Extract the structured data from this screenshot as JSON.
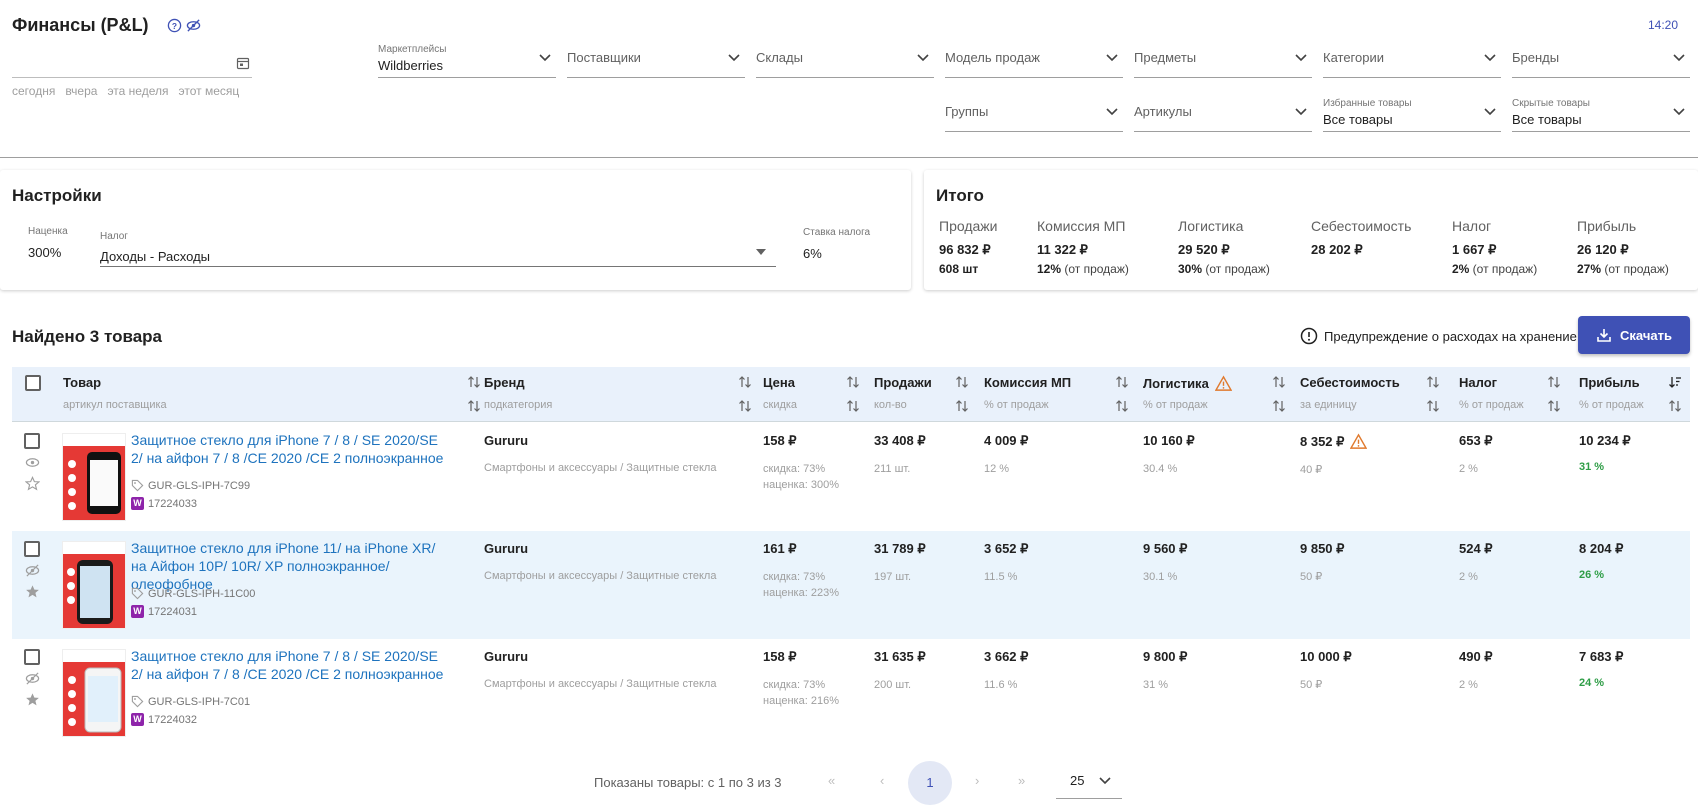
{
  "header": {
    "title": "Финансы (P&L)",
    "time": "14:20"
  },
  "date": {
    "value": "",
    "quick": [
      "сегодня",
      "вчера",
      "эта неделя",
      "этот месяц"
    ]
  },
  "filters": {
    "marketplaces": {
      "label": "Маркетплейсы",
      "value": "Wildberries"
    },
    "suppliers": {
      "placeholder": "Поставщики"
    },
    "warehouses": {
      "placeholder": "Склады"
    },
    "sales_model": {
      "placeholder": "Модель продаж"
    },
    "subjects": {
      "placeholder": "Предметы"
    },
    "categories": {
      "placeholder": "Категории"
    },
    "brands": {
      "placeholder": "Бренды"
    },
    "groups": {
      "placeholder": "Группы"
    },
    "articles": {
      "placeholder": "Артикулы"
    },
    "favorites": {
      "label": "Избранные товары",
      "value": "Все товары"
    },
    "hidden": {
      "label": "Скрытые товары",
      "value": "Все товары"
    }
  },
  "settings": {
    "title": "Настройки",
    "markup_label": "Наценка",
    "markup_value": "300%",
    "tax_label": "Налог",
    "tax_value": "Доходы - Расходы",
    "rate_label": "Ставка налога",
    "rate_value": "6%"
  },
  "totals": {
    "title": "Итого",
    "sales": {
      "label": "Продажи",
      "value": "96 832 ₽",
      "sub": "608 шт"
    },
    "commission": {
      "label": "Комиссия МП",
      "value": "11 322 ₽",
      "pct": "12%",
      "note": " (от продаж)"
    },
    "logistics": {
      "label": "Логистика",
      "value": "29 520 ₽",
      "pct": "30%",
      "note": " (от продаж)"
    },
    "cost": {
      "label": "Себестоимость",
      "value": "28 202 ₽"
    },
    "tax": {
      "label": "Налог",
      "value": "1 667 ₽",
      "pct": "2%",
      "note": " (от продаж)"
    },
    "profit": {
      "label": "Прибыль",
      "value": "26 120 ₽",
      "pct": "27%",
      "note": " (от продаж)"
    }
  },
  "found": "Найдено 3 товара",
  "warning": "Предупреждение о расходах на хранение",
  "download": "Скачать",
  "columns": {
    "product": {
      "t": "Товар",
      "s": "артикул поставщика"
    },
    "brand": {
      "t": "Бренд",
      "s": "подкатегория"
    },
    "price": {
      "t": "Цена",
      "s": "скидка"
    },
    "sales": {
      "t": "Продажи",
      "s": "кол-во"
    },
    "commission": {
      "t": "Комиссия МП",
      "s": "% от продаж"
    },
    "logistics": {
      "t": "Логистика",
      "s": "% от продаж"
    },
    "cost": {
      "t": "Себестоимость",
      "s": "за единицу"
    },
    "tax": {
      "t": "Налог",
      "s": "% от продаж"
    },
    "profit": {
      "t": "Прибыль",
      "s": "% от продаж"
    }
  },
  "rows": [
    {
      "name": "Защитное стекло для iPhone 7 / 8 / SE 2020/SE 2/ на айфон 7 / 8 /CE 2020 /CE 2 полноэкранное",
      "sku": "GUR-GLS-IPH-7C99",
      "id": "17224033",
      "brand": "Gururu",
      "subcat": "Смартфоны и аксессуары / Защитные стекла",
      "price": "158 ₽",
      "discount": "скидка: 73%",
      "markup": "наценка: 300%",
      "sales": "33 408 ₽",
      "qty": "211 шт.",
      "commission": "4 009 ₽",
      "commission_pct": "12 %",
      "logistics": "10 160 ₽",
      "logistics_pct": "30.4 %",
      "cost": "8 352 ₽",
      "cost_unit": "40 ₽",
      "tax": "653 ₽",
      "tax_pct": "2 %",
      "profit": "10 234 ₽",
      "profit_pct": "31 %"
    },
    {
      "name": "Защитное стекло для iPhone 11/ на iPhone XR/ на Айфон 10Р/ 10R/ XP полноэкранное/ олеофобное",
      "sku": "GUR-GLS-IPH-11C00",
      "id": "17224031",
      "brand": "Gururu",
      "subcat": "Смартфоны и аксессуары / Защитные стекла",
      "price": "161 ₽",
      "discount": "скидка: 73%",
      "markup": "наценка: 223%",
      "sales": "31 789 ₽",
      "qty": "197 шт.",
      "commission": "3 652 ₽",
      "commission_pct": "11.5 %",
      "logistics": "9 560 ₽",
      "logistics_pct": "30.1 %",
      "cost": "9 850 ₽",
      "cost_unit": "50 ₽",
      "tax": "524 ₽",
      "tax_pct": "2 %",
      "profit": "8 204 ₽",
      "profit_pct": "26 %"
    },
    {
      "name": "Защитное стекло для iPhone 7 / 8 / SE 2020/SE 2/ на айфон 7 / 8 /CE 2020 /CE 2 полноэкранное",
      "sku": "GUR-GLS-IPH-7C01",
      "id": "17224032",
      "brand": "Gururu",
      "subcat": "Смартфоны и аксессуары / Защитные стекла",
      "price": "158 ₽",
      "discount": "скидка: 73%",
      "markup": "наценка: 216%",
      "sales": "31 635 ₽",
      "qty": "200 шт.",
      "commission": "3 662 ₽",
      "commission_pct": "11.6 %",
      "logistics": "9 800 ₽",
      "logistics_pct": "31 %",
      "cost": "10 000 ₽",
      "cost_unit": "50 ₽",
      "tax": "490 ₽",
      "tax_pct": "2 %",
      "profit": "7 683 ₽",
      "profit_pct": "24 %"
    }
  ],
  "pagination": {
    "text": "Показаны товары: с 1 по 3 из 3",
    "current": "1",
    "page_size": "25",
    "first": "«",
    "prev": "‹",
    "next": "›",
    "last": "»"
  }
}
